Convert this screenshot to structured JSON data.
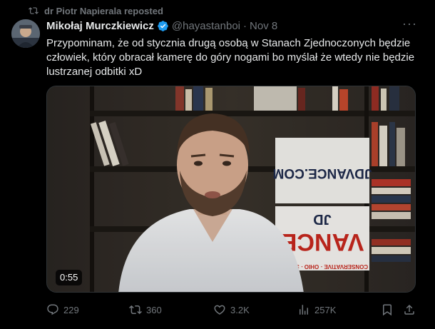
{
  "repost": {
    "label": "dr Piotr Napierala reposted"
  },
  "author": {
    "name": "Mikołaj Murczkiewicz",
    "handle": "@hayastanboi",
    "separator": "·",
    "date": "Nov 8"
  },
  "tweet": {
    "text": "Przypominam, że od stycznia drugą osobą w Stanach Zjednoczonych będzie człowiek, który obracał kamerę do góry nogami bo myślał że wtedy nie będzie lustrzanej odbitki xD"
  },
  "video": {
    "duration": "0:55",
    "sign_top": "JDVANCE.COM",
    "sign_jd": "JD",
    "sign_vance": "VANCE",
    "sign_tag": "CONSERVATIVE · OHIO · SENATE"
  },
  "actions": {
    "replies": "229",
    "reposts": "360",
    "likes": "3.2K",
    "views": "257K"
  },
  "icons": {
    "repost": "repost-icon",
    "verified": "verified-icon",
    "more": "more-icon",
    "reply": "reply-icon",
    "like": "heart-icon",
    "views": "views-icon",
    "bookmark": "bookmark-icon",
    "share": "share-icon"
  },
  "colors": {
    "background": "#000000",
    "text": "#e7e9ea",
    "muted": "#71767b",
    "verified": "#1d9bf0"
  }
}
